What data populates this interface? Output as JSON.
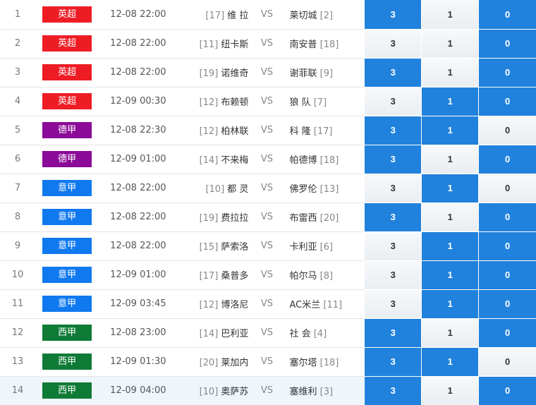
{
  "colors": {
    "英超": "#ee1c25",
    "德甲": "#8b0a98",
    "意甲": "#1079f0",
    "西甲": "#0e7a35",
    "selected": "#2082dc"
  },
  "matches": [
    {
      "num": "1",
      "league": "英超",
      "time": "12-08 22:00",
      "home_rank": "[17]",
      "home": "维 拉",
      "vs": "VS",
      "away": "莱切城",
      "away_rank": "[2]",
      "odds": [
        "3",
        "1",
        "0"
      ],
      "selected": [
        true,
        false,
        true
      ]
    },
    {
      "num": "2",
      "league": "英超",
      "time": "12-08 22:00",
      "home_rank": "[11]",
      "home": "纽卡斯",
      "vs": "VS",
      "away": "南安普",
      "away_rank": "[18]",
      "odds": [
        "3",
        "1",
        "0"
      ],
      "selected": [
        false,
        false,
        true
      ]
    },
    {
      "num": "3",
      "league": "英超",
      "time": "12-08 22:00",
      "home_rank": "[19]",
      "home": "诺维奇",
      "vs": "VS",
      "away": "谢菲联",
      "away_rank": "[9]",
      "odds": [
        "3",
        "1",
        "0"
      ],
      "selected": [
        true,
        false,
        true
      ]
    },
    {
      "num": "4",
      "league": "英超",
      "time": "12-09 00:30",
      "home_rank": "[12]",
      "home": "布赖顿",
      "vs": "VS",
      "away": "狼 队",
      "away_rank": "[7]",
      "odds": [
        "3",
        "1",
        "0"
      ],
      "selected": [
        false,
        true,
        true
      ]
    },
    {
      "num": "5",
      "league": "德甲",
      "time": "12-08 22:30",
      "home_rank": "[12]",
      "home": "柏林联",
      "vs": "VS",
      "away": "科 隆",
      "away_rank": "[17]",
      "odds": [
        "3",
        "1",
        "0"
      ],
      "selected": [
        true,
        true,
        false
      ]
    },
    {
      "num": "6",
      "league": "德甲",
      "time": "12-09 01:00",
      "home_rank": "[14]",
      "home": "不来梅",
      "vs": "VS",
      "away": "帕德博",
      "away_rank": "[18]",
      "odds": [
        "3",
        "1",
        "0"
      ],
      "selected": [
        true,
        false,
        true
      ]
    },
    {
      "num": "7",
      "league": "意甲",
      "time": "12-08 22:00",
      "home_rank": "[10]",
      "home": "都 灵",
      "vs": "VS",
      "away": "佛罗伦",
      "away_rank": "[13]",
      "odds": [
        "3",
        "1",
        "0"
      ],
      "selected": [
        false,
        true,
        false
      ]
    },
    {
      "num": "8",
      "league": "意甲",
      "time": "12-08 22:00",
      "home_rank": "[19]",
      "home": "费拉拉",
      "vs": "VS",
      "away": "布雷西",
      "away_rank": "[20]",
      "odds": [
        "3",
        "1",
        "0"
      ],
      "selected": [
        true,
        false,
        true
      ]
    },
    {
      "num": "9",
      "league": "意甲",
      "time": "12-08 22:00",
      "home_rank": "[15]",
      "home": "萨索洛",
      "vs": "VS",
      "away": "卡利亚",
      "away_rank": "[6]",
      "odds": [
        "3",
        "1",
        "0"
      ],
      "selected": [
        false,
        true,
        true
      ]
    },
    {
      "num": "10",
      "league": "意甲",
      "time": "12-09 01:00",
      "home_rank": "[17]",
      "home": "桑普多",
      "vs": "VS",
      "away": "帕尔马",
      "away_rank": "[8]",
      "odds": [
        "3",
        "1",
        "0"
      ],
      "selected": [
        false,
        true,
        true
      ]
    },
    {
      "num": "11",
      "league": "意甲",
      "time": "12-09 03:45",
      "home_rank": "[12]",
      "home": "博洛尼",
      "vs": "VS",
      "away": "AC米兰",
      "away_rank": "[11]",
      "odds": [
        "3",
        "1",
        "0"
      ],
      "selected": [
        false,
        true,
        true
      ]
    },
    {
      "num": "12",
      "league": "西甲",
      "time": "12-08 23:00",
      "home_rank": "[14]",
      "home": "巴利亚",
      "vs": "VS",
      "away": "社 会",
      "away_rank": "[4]",
      "odds": [
        "3",
        "1",
        "0"
      ],
      "selected": [
        true,
        false,
        true
      ]
    },
    {
      "num": "13",
      "league": "西甲",
      "time": "12-09 01:30",
      "home_rank": "[20]",
      "home": "莱加内",
      "vs": "VS",
      "away": "塞尔塔",
      "away_rank": "[18]",
      "odds": [
        "3",
        "1",
        "0"
      ],
      "selected": [
        true,
        true,
        false
      ]
    },
    {
      "num": "14",
      "league": "西甲",
      "time": "12-09 04:00",
      "home_rank": "[10]",
      "home": "奥萨苏",
      "vs": "VS",
      "away": "塞维利",
      "away_rank": "[3]",
      "odds": [
        "3",
        "1",
        "0"
      ],
      "selected": [
        true,
        false,
        true
      ]
    }
  ]
}
